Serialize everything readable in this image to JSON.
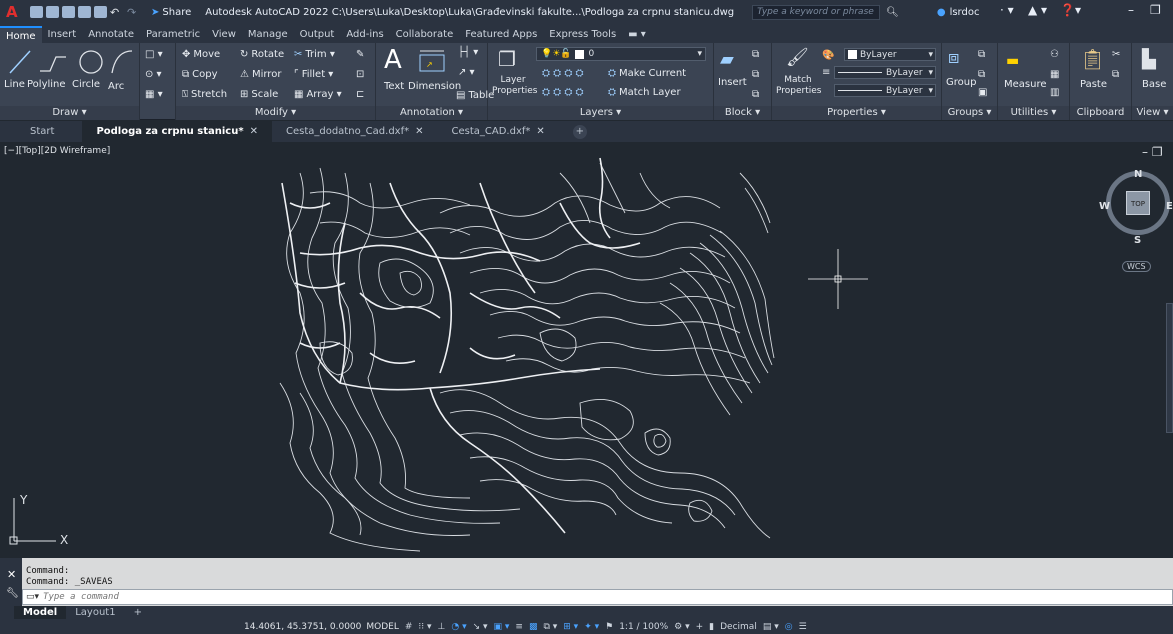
{
  "titlebar": {
    "share": "Share",
    "title": "Autodesk AutoCAD 2022   C:\\Users\\Luka\\Desktop\\Luka\\Građevinski fakulte...\\Podloga za crpnu stanicu.dwg",
    "search_placeholder": "Type a keyword or phrase",
    "user": "lsrdoc"
  },
  "ribbon_tabs": [
    "Home",
    "Insert",
    "Annotate",
    "Parametric",
    "View",
    "Manage",
    "Output",
    "Add-ins",
    "Collaborate",
    "Featured Apps",
    "Express Tools"
  ],
  "ribbon": {
    "draw": {
      "title": "Draw ▾",
      "line": "Line",
      "polyline": "Polyline",
      "circle": "Circle",
      "arc": "Arc"
    },
    "modify": {
      "title": "Modify ▾",
      "move": "Move",
      "rotate": "Rotate",
      "trim": "Trim ▾",
      "copy": "Copy",
      "mirror": "Mirror",
      "fillet": "Fillet ▾",
      "stretch": "Stretch",
      "scale": "Scale",
      "array": "Array ▾"
    },
    "annotation": {
      "title": "Annotation ▾",
      "text": "Text",
      "dimension": "Dimension",
      "table": "Table"
    },
    "layers": {
      "title": "Layers ▾",
      "layer_properties": "Layer Properties",
      "make_current": "Make Current",
      "match_layer": "Match Layer",
      "current_layer": "0"
    },
    "block": {
      "title": "Block ▾",
      "insert": "Insert"
    },
    "properties": {
      "title": "Properties ▾",
      "match_properties": "Match Properties",
      "color": "ByLayer",
      "linetype": "ByLayer",
      "lineweight": "ByLayer"
    },
    "groups": {
      "title": "Groups ▾",
      "group": "Group"
    },
    "utilities": {
      "title": "Utilities ▾",
      "measure": "Measure"
    },
    "clipboard": {
      "title": "Clipboard",
      "paste": "Paste"
    },
    "view": {
      "title": "View ▾",
      "base": "Base"
    }
  },
  "doc_tabs": [
    {
      "label": "Start",
      "close": ""
    },
    {
      "label": "Podloga za crpnu stanicu*",
      "close": "✕"
    },
    {
      "label": "Cesta_dodatno_Cad.dxf*",
      "close": "✕"
    },
    {
      "label": "Cesta_CAD.dxf*",
      "close": "✕"
    }
  ],
  "viewport": {
    "label": "[−][Top][2D Wireframe]",
    "viewcube": {
      "n": "N",
      "s": "S",
      "e": "E",
      "w": "W",
      "top": "TOP",
      "wcs": "WCS"
    },
    "ucs": {
      "x": "X",
      "y": "Y"
    }
  },
  "command": {
    "history": [
      "Command:",
      "Command:  _SAVEAS"
    ],
    "placeholder": "Type a command"
  },
  "layout_tabs": [
    "Model",
    "Layout1",
    "+"
  ],
  "statusbar": {
    "coords": "14.4061, 45.3751, 0.0000",
    "model": "MODEL",
    "scale": "1:1 / 100%",
    "units": "Decimal"
  },
  "colors": {
    "ribbon_bg": "#3b4453",
    "viewport_bg": "#212830",
    "accent": "#1f8fff"
  }
}
